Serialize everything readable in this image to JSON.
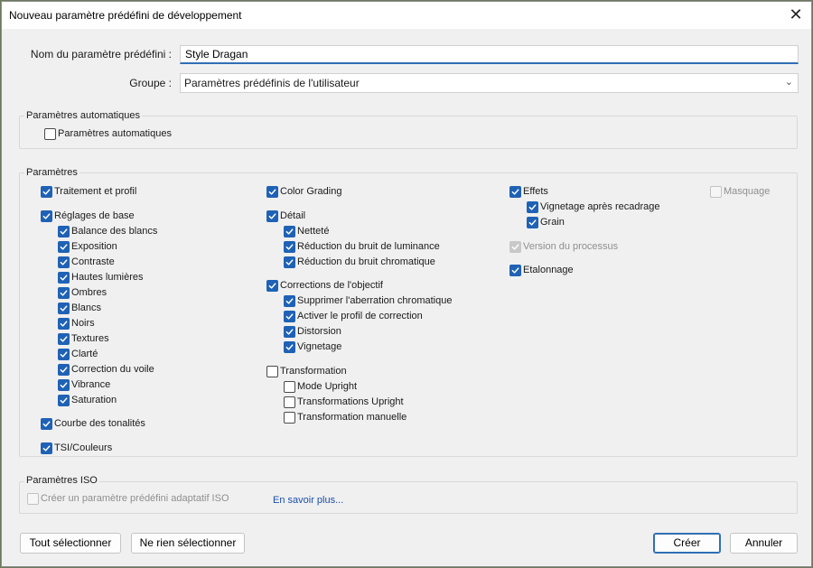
{
  "window": {
    "title": "Nouveau paramètre prédéfini de développement",
    "close": "✕"
  },
  "form": {
    "name_label": "Nom du paramètre prédéfini :",
    "name_value": "Style Dragan",
    "group_label": "Groupe :",
    "group_value": "Paramètres prédéfinis de l'utilisateur"
  },
  "auto_section": {
    "title": "Paramètres automatiques",
    "checkbox": {
      "label": "Paramètres automatiques",
      "checked": false
    }
  },
  "params_section": {
    "title": "Paramètres",
    "col1": [
      {
        "label": "Traitement et profil",
        "checked": true
      },
      {
        "label": "Réglages de base",
        "checked": true
      },
      {
        "label": "Balance des blancs",
        "checked": true
      },
      {
        "label": "Exposition",
        "checked": true
      },
      {
        "label": "Contraste",
        "checked": true
      },
      {
        "label": "Hautes lumières",
        "checked": true
      },
      {
        "label": "Ombres",
        "checked": true
      },
      {
        "label": "Blancs",
        "checked": true
      },
      {
        "label": "Noirs",
        "checked": true
      },
      {
        "label": "Textures",
        "checked": true
      },
      {
        "label": "Clarté",
        "checked": true
      },
      {
        "label": "Correction du voile",
        "checked": true
      },
      {
        "label": "Vibrance",
        "checked": true
      },
      {
        "label": "Saturation",
        "checked": true
      },
      {
        "label": "Courbe des tonalités",
        "checked": true
      },
      {
        "label": "TSI/Couleurs",
        "checked": true
      }
    ],
    "col2": [
      {
        "label": "Color Grading",
        "checked": true
      },
      {
        "label": "Détail",
        "checked": true
      },
      {
        "label": "Netteté",
        "checked": true
      },
      {
        "label": "Réduction du bruit de luminance",
        "checked": true
      },
      {
        "label": "Réduction du bruit chromatique",
        "checked": true
      },
      {
        "label": "Corrections de l'objectif",
        "checked": true
      },
      {
        "label": "Supprimer l'aberration chromatique",
        "checked": true
      },
      {
        "label": "Activer le profil de correction",
        "checked": true
      },
      {
        "label": "Distorsion",
        "checked": true
      },
      {
        "label": "Vignetage",
        "checked": true
      },
      {
        "label": "Transformation",
        "checked": false
      },
      {
        "label": "Mode Upright",
        "checked": false
      },
      {
        "label": "Transformations Upright",
        "checked": false
      },
      {
        "label": "Transformation manuelle",
        "checked": false
      }
    ],
    "col3": [
      {
        "label": "Effets",
        "checked": true
      },
      {
        "label": "Vignetage après recadrage",
        "checked": true
      },
      {
        "label": "Grain",
        "checked": true
      },
      {
        "label": "Version du processus",
        "checked": true,
        "disabled": true
      },
      {
        "label": "Etalonnage",
        "checked": true
      }
    ],
    "col4": [
      {
        "label": "Masquage",
        "checked": false,
        "disabled": true
      }
    ]
  },
  "iso_section": {
    "title": "Paramètres ISO",
    "checkbox": {
      "label": "Créer un paramètre prédéfini adaptatif ISO",
      "checked": false,
      "disabled": true
    },
    "link": "En savoir plus..."
  },
  "buttons": {
    "select_all": "Tout sélectionner",
    "select_none": "Ne rien sélectionner",
    "create": "Créer",
    "cancel": "Annuler"
  },
  "colors": {
    "accent": "#1f62b5",
    "link": "#1a4fa8"
  }
}
